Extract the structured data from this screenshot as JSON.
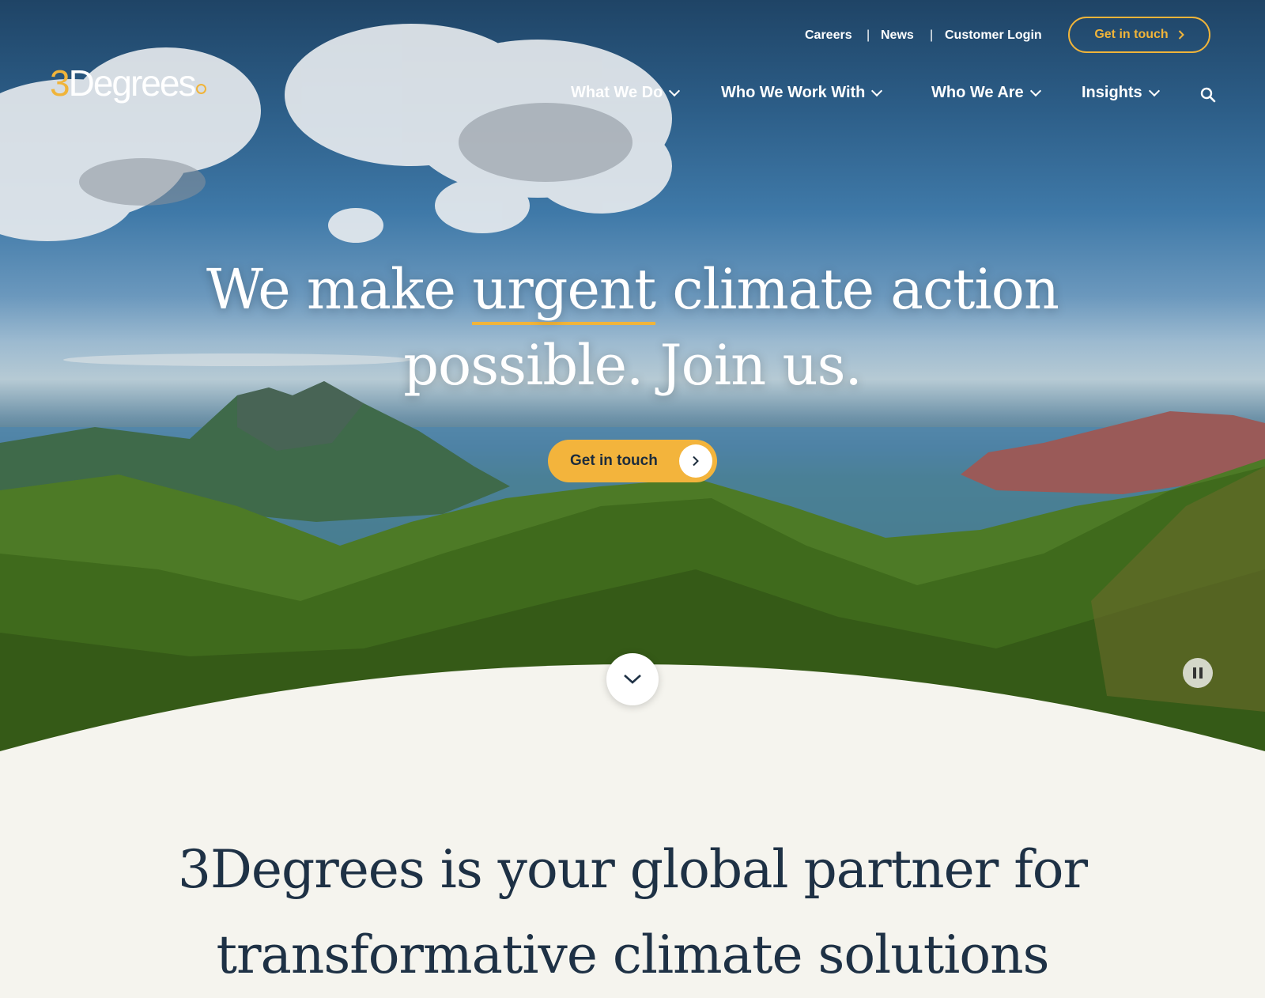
{
  "brand": {
    "logo_digit": "3",
    "logo_word": "Degrees",
    "accent": "#f0b43a",
    "navy": "#1e3145"
  },
  "utility": {
    "careers": "Careers",
    "news": "News",
    "login": "Customer Login",
    "cta": "Get in touch",
    "separator": "|"
  },
  "nav": {
    "items": [
      {
        "label": "What We Do"
      },
      {
        "label": "Who We Work With"
      },
      {
        "label": "Who We Are"
      },
      {
        "label": "Insights"
      }
    ],
    "search_icon": "search-icon"
  },
  "hero": {
    "headline_before": "We make ",
    "headline_highlight": "urgent",
    "headline_after_line1": " climate action",
    "headline_line2": "possible. Join us.",
    "cta": "Get in touch",
    "scroll_icon": "chevron-down-icon",
    "pause_icon": "pause-icon"
  },
  "intro": {
    "heading": "3Degrees is your global partner for transformative climate solutions"
  }
}
